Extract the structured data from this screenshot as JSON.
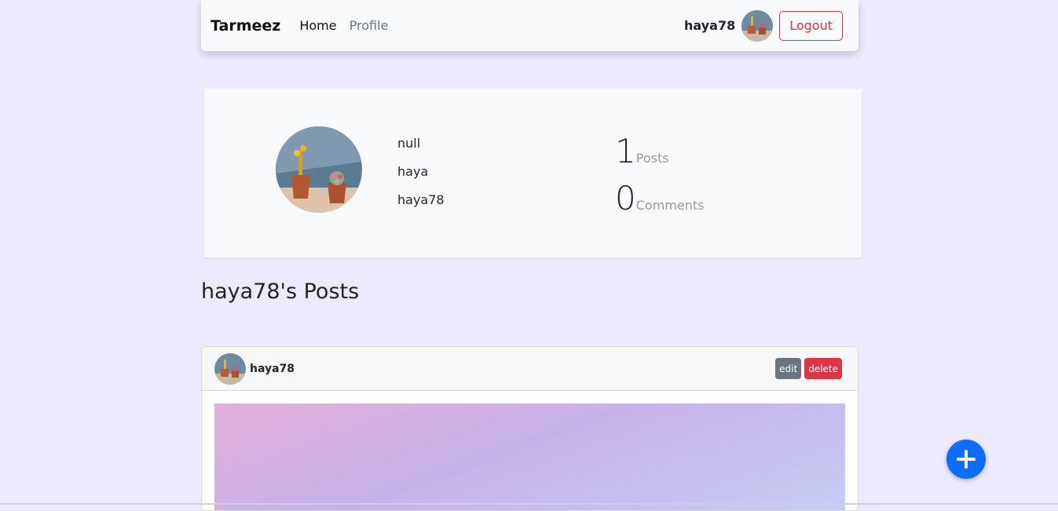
{
  "navbar": {
    "brand": "Tarmeez",
    "links": [
      {
        "label": "Home"
      },
      {
        "label": "Profile"
      }
    ],
    "username": "haya78",
    "logout_label": "Logout"
  },
  "profile": {
    "email": "null",
    "name": "haya",
    "username": "haya78",
    "stats": {
      "posts_count": "1",
      "posts_label": "Posts",
      "comments_count": "0",
      "comments_label": "Comments"
    }
  },
  "posts_section": {
    "title": "haya78's Posts"
  },
  "post": {
    "author": "haya78",
    "edit_label": "edit",
    "delete_label": "delete"
  },
  "fab": {
    "icon": "plus-icon"
  },
  "colors": {
    "background": "#ede9fe",
    "primary": "#0d6efd",
    "danger": "#dc3545",
    "secondary": "#6c757d"
  }
}
